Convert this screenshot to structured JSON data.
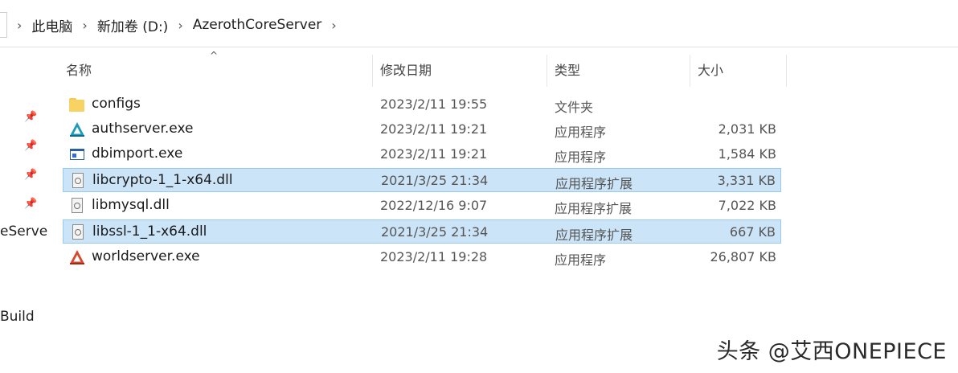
{
  "breadcrumb": {
    "items": [
      "此电脑",
      "新加卷 (D:)",
      "AzerothCoreServer"
    ],
    "separator": "›"
  },
  "nav_pane": {
    "partial_labels": [
      "eServe",
      "Build"
    ]
  },
  "columns": {
    "name": "名称",
    "date": "修改日期",
    "type": "类型",
    "size": "大小"
  },
  "files": [
    {
      "name": "configs",
      "date": "2023/2/11 19:55",
      "type": "文件夹",
      "size": "",
      "icon": "folder-icon",
      "selected": false
    },
    {
      "name": "authserver.exe",
      "date": "2023/2/11 19:21",
      "type": "应用程序",
      "size": "2,031 KB",
      "icon": "authserver-icon",
      "selected": false
    },
    {
      "name": "dbimport.exe",
      "date": "2023/2/11 19:21",
      "type": "应用程序",
      "size": "1,584 KB",
      "icon": "app-window-icon",
      "selected": false
    },
    {
      "name": "libcrypto-1_1-x64.dll",
      "date": "2021/3/25 21:34",
      "type": "应用程序扩展",
      "size": "3,331 KB",
      "icon": "dll-icon",
      "selected": true
    },
    {
      "name": "libmysql.dll",
      "date": "2022/12/16 9:07",
      "type": "应用程序扩展",
      "size": "7,022 KB",
      "icon": "dll-icon",
      "selected": false
    },
    {
      "name": "libssl-1_1-x64.dll",
      "date": "2021/3/25 21:34",
      "type": "应用程序扩展",
      "size": "667 KB",
      "icon": "dll-icon",
      "selected": true
    },
    {
      "name": "worldserver.exe",
      "date": "2023/2/11 19:28",
      "type": "应用程序",
      "size": "26,807 KB",
      "icon": "worldserver-icon",
      "selected": false
    }
  ],
  "watermark": "头条 @艾西ONEPIECE",
  "colors": {
    "selection_bg": "#cce4f7",
    "selection_border": "#99c9ef",
    "folder": "#f8d263",
    "authserver": "#1e9bb8",
    "worldserver": "#d9472b"
  }
}
